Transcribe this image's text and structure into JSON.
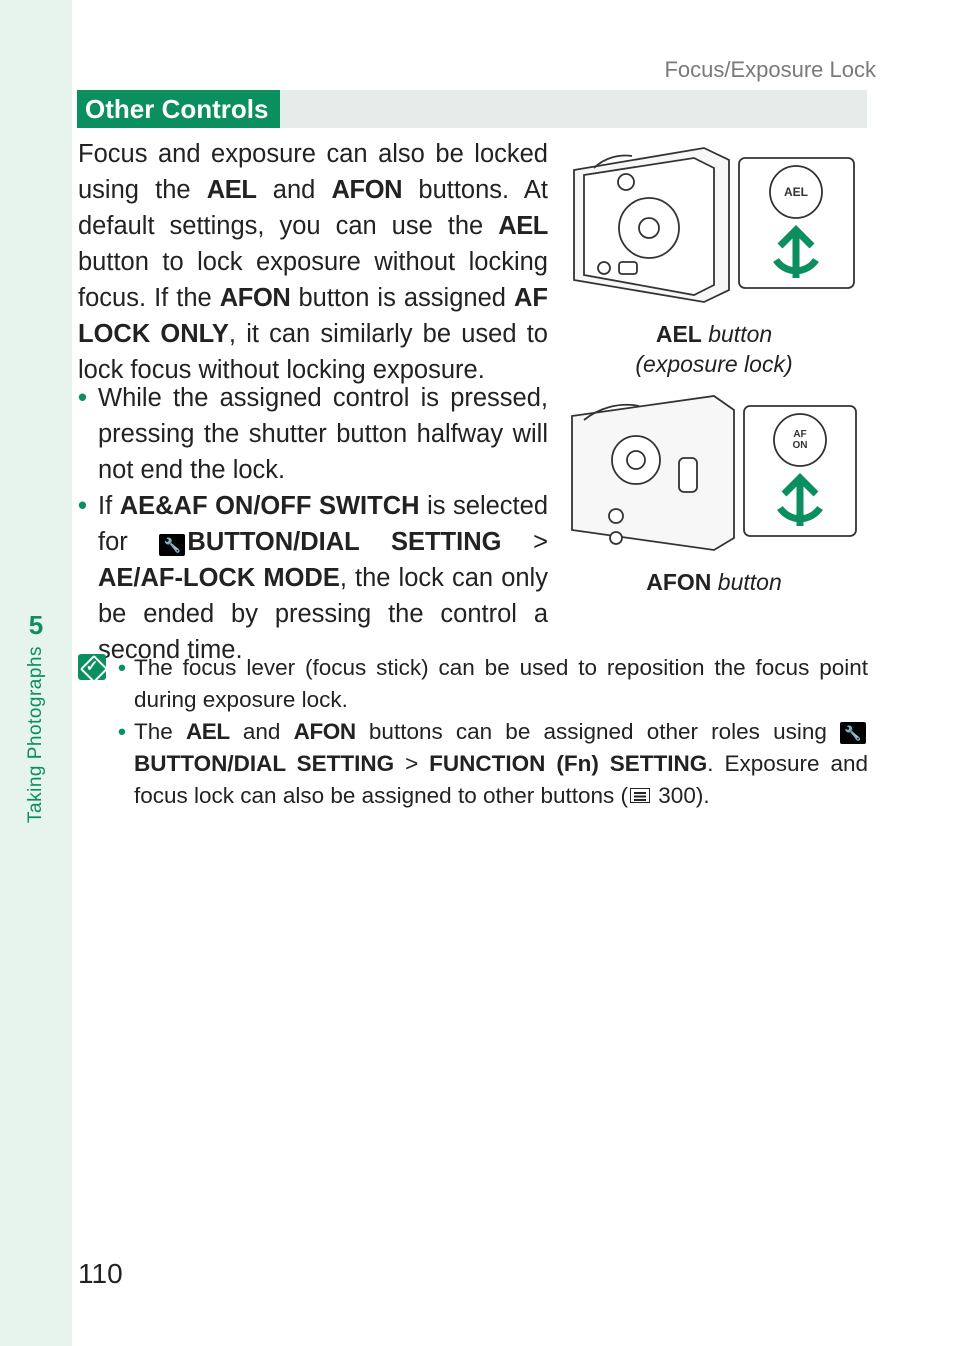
{
  "runningHead": "Focus/Exposure Lock",
  "chapterNumber": "5",
  "sideLabel": "Taking Photographs",
  "sectionTitle": "Other Controls",
  "para1_a": "Focus and exposure can also be locked using the ",
  "para1_b": "AEL",
  "para1_c": " and ",
  "para1_d": "AFON",
  "para1_e": " buttons. At default settings, you can use the ",
  "para1_f": "AEL",
  "para1_g": " button to lock exposure without locking focus. If the ",
  "para1_h": "AFON",
  "para1_i": " button is assigned ",
  "para1_j": "AF LOCK ONLY",
  "para1_k": ", it can similarly be used to lock focus without locking exposure.",
  "list1_item1": "While the assigned control is pressed, pressing the shutter button halfway will not end the lock.",
  "list1_item2_a": "If ",
  "list1_item2_b": "AE&AF ON/OFF SWITCH",
  "list1_item2_c": " is selected for ",
  "list1_item2_d": "BUTTON/DIAL SETTING",
  "list1_item2_e": " > ",
  "list1_item2_f": "AE/AF-LOCK MODE",
  "list1_item2_g": ", the lock can only be ended by pressing the control a second time.",
  "fig1_caption_b": "AEL",
  "fig1_caption_i": " button\n(exposure lock)",
  "fig2_caption_b": "AFON",
  "fig2_caption_i": " button",
  "note1": "The focus lever (focus stick) can be used to reposition the focus point during exposure lock.",
  "note2_a": "The ",
  "note2_b": "AEL",
  "note2_c": " and ",
  "note2_d": "AFON",
  "note2_e": " buttons can be assigned other roles using ",
  "note2_f": " BUTTON/DIAL SETTING",
  "note2_g": " > ",
  "note2_h": "FUNCTION (Fn) SETTING",
  "note2_i": ". Exposure and focus lock can also be assigned to other buttons (",
  "note2_j": " 300).",
  "pageNumber": "110",
  "btnLabelAEL": "AEL",
  "btnLabelAFON1": "AF",
  "btnLabelAFON2": "ON"
}
